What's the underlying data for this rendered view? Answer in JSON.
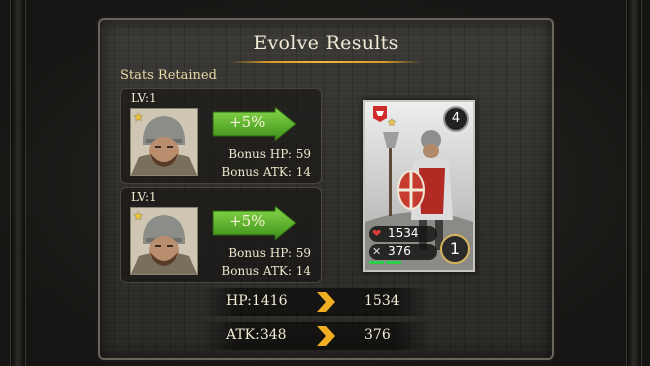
{
  "title": "Evolve Results",
  "section_label": "Stats Retained",
  "cards": [
    {
      "level": "LV:1",
      "boost": "+5%",
      "bonus_hp": "Bonus HP: 59",
      "bonus_atk": "Bonus ATK: 14"
    },
    {
      "level": "LV:1",
      "boost": "+5%",
      "bonus_hp": "Bonus HP: 59",
      "bonus_atk": "Bonus ATK: 14"
    }
  ],
  "result_card": {
    "level": "4",
    "hp": "1534",
    "atk": "376",
    "rank": "1"
  },
  "comparison": [
    {
      "label": "HP:1416",
      "new": "1534"
    },
    {
      "label": "ATK:348",
      "new": "376"
    }
  ],
  "colors": {
    "accent_gold": "#f0b73a",
    "boost_green": "#5fb92c",
    "panel": "#33322f"
  }
}
